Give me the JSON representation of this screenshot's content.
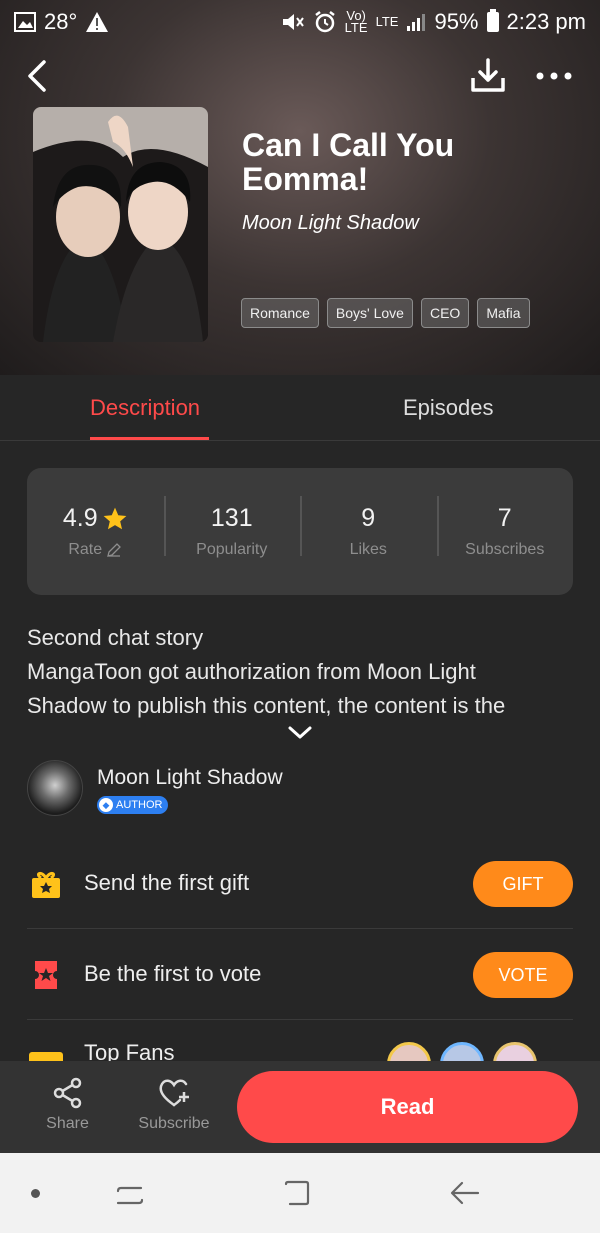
{
  "status_bar": {
    "temperature": "28°",
    "signal_label_top": "Vo)",
    "signal_label_bottom": "LTE",
    "network": "LTE",
    "battery": "95%",
    "time": "2:23 pm"
  },
  "header": {
    "title": "Can I Call You Eomma!",
    "author": "Moon Light Shadow",
    "tags": [
      "Romance",
      "Boys' Love",
      "CEO",
      "Mafia"
    ]
  },
  "tabs": {
    "description": "Description",
    "episodes": "Episodes",
    "active": "description"
  },
  "stats": {
    "rating": {
      "value": "4.9",
      "label": "Rate"
    },
    "popularity": {
      "value": "131",
      "label": "Popularity"
    },
    "likes": {
      "value": "9",
      "label": "Likes"
    },
    "subscribes": {
      "value": "7",
      "label": "Subscribes"
    }
  },
  "description": {
    "line1": "Second chat story",
    "line2": "MangaToon got authorization from Moon Light",
    "line3": "Shadow to publish this content, the content is the"
  },
  "author_section": {
    "name": "Moon Light Shadow",
    "badge": "AUTHOR"
  },
  "actions": {
    "gift_label": "Send the first gift",
    "gift_button": "GIFT",
    "vote_label": "Be the first to vote",
    "vote_button": "VOTE",
    "fans_label": "Top Fans"
  },
  "bottom_bar": {
    "share": "Share",
    "subscribe": "Subscribe",
    "read": "Read"
  },
  "colors": {
    "accent_red": "#ff4a4a",
    "accent_orange": "#ff8a1a",
    "star_yellow": "#ffc21a",
    "author_blue": "#2d7ff1"
  },
  "icons": [
    "image-icon",
    "warning-icon",
    "mute-icon",
    "alarm-icon",
    "signal-icon",
    "battery-icon",
    "back-arrow-icon",
    "download-icon",
    "more-icon",
    "star-icon",
    "edit-icon",
    "chevron-down-icon",
    "gift-icon",
    "ticket-icon",
    "trophy-icon",
    "share-icon",
    "heart-plus-icon"
  ]
}
